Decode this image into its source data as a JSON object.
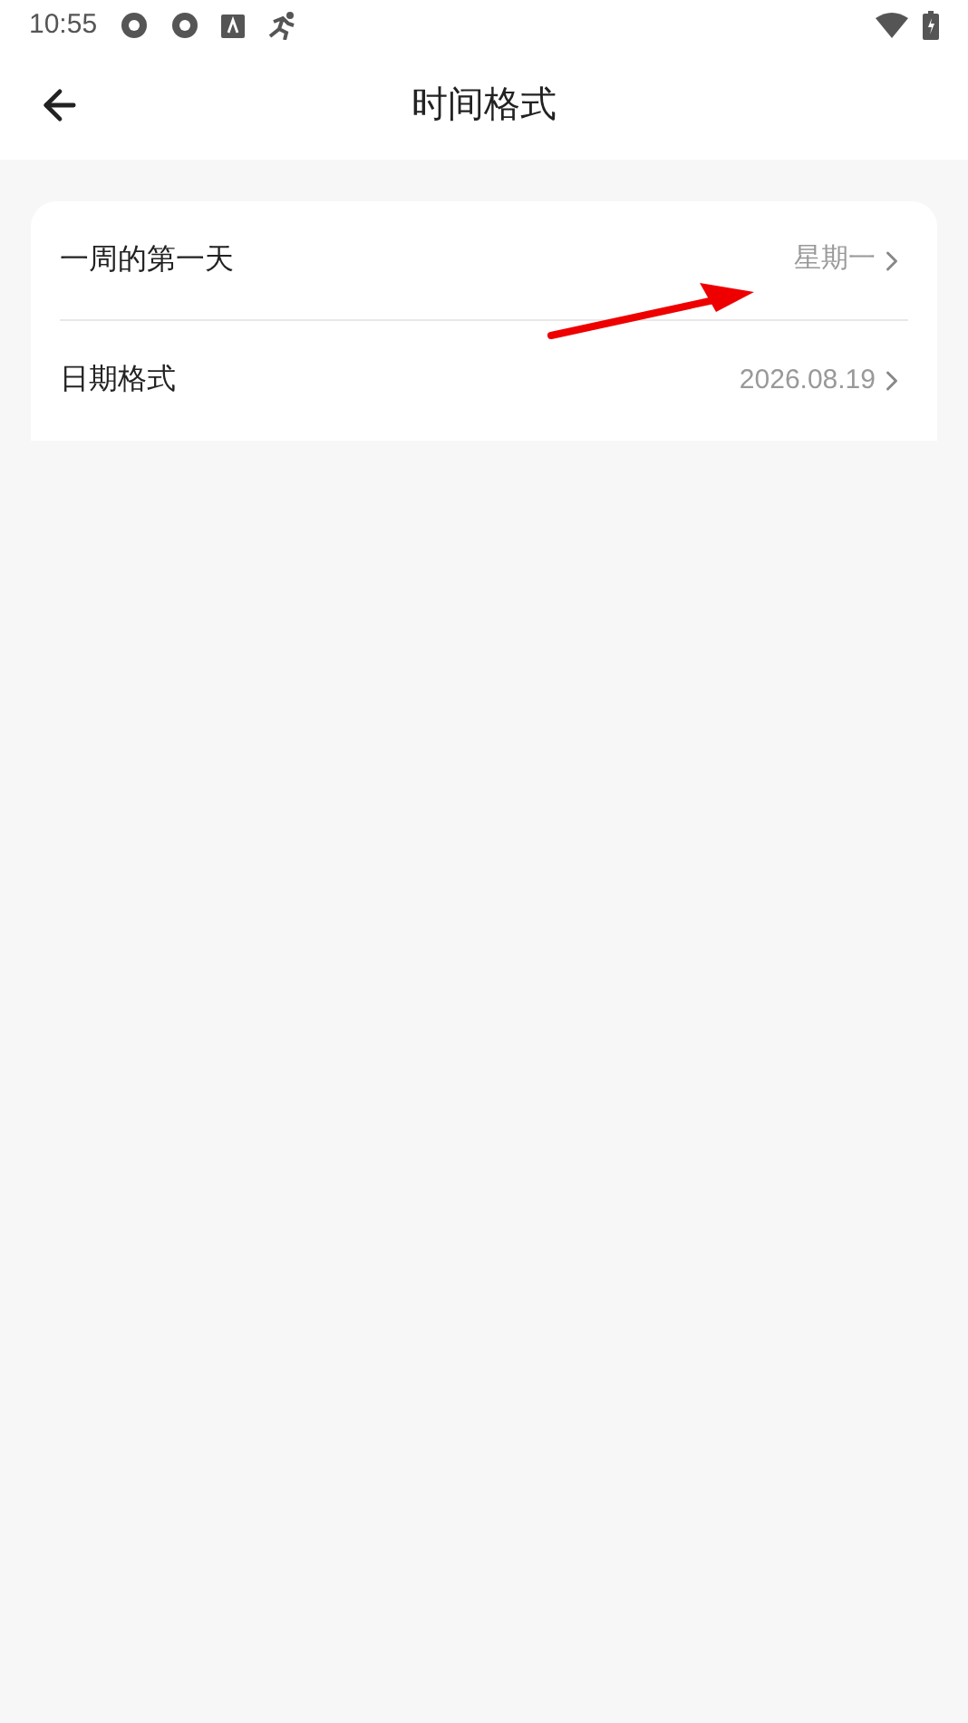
{
  "status_bar": {
    "time": "10:55"
  },
  "header": {
    "title": "时间格式"
  },
  "settings": [
    {
      "label": "一周的第一天",
      "value": "星期一"
    },
    {
      "label": "日期格式",
      "value": "2026.08.19"
    }
  ]
}
